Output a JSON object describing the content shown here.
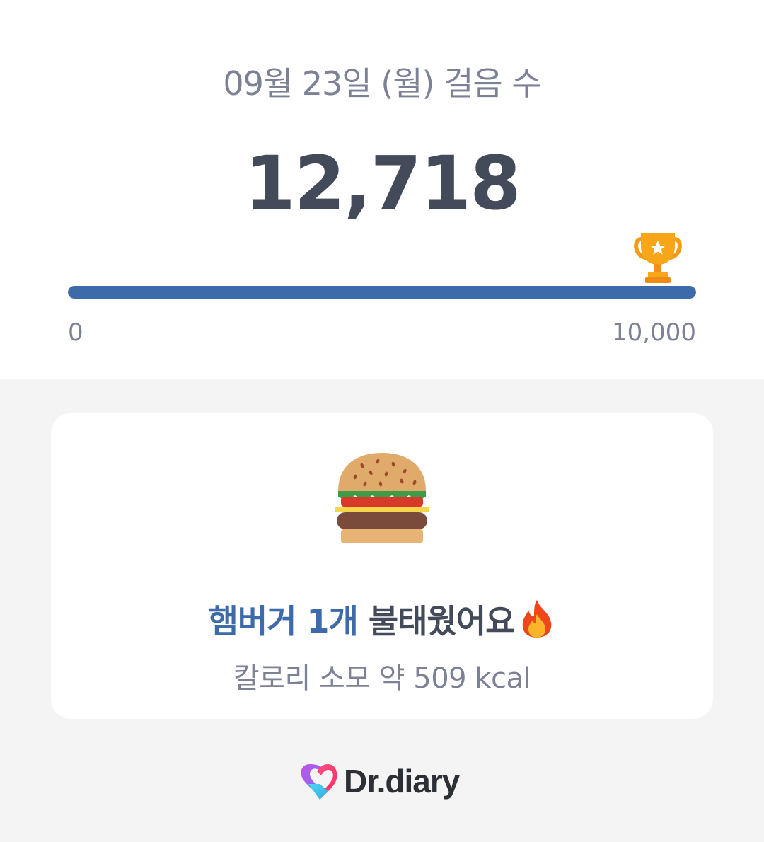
{
  "header": {
    "date_title": "09월 23일 (월) 걸음 수",
    "step_count": "12,718"
  },
  "progress": {
    "min_label": "0",
    "max_label": "10,000",
    "fill_fraction": 1.0,
    "fill_color": "#3d6aa9",
    "goal_icon": "trophy-icon"
  },
  "card": {
    "food_icon": "hamburger-icon",
    "headline_accent": "햄버거 1개",
    "headline_rest": " 불태웠어요",
    "headline_icon": "fire-icon",
    "calories_text": "칼로리 소모 약 509 kcal"
  },
  "brand": {
    "name": "Dr.diary",
    "logo_icon": "heart-logo-icon"
  },
  "colors": {
    "accent": "#3d6aa9",
    "text_dark": "#434a5a",
    "text_muted": "#7c8196"
  }
}
